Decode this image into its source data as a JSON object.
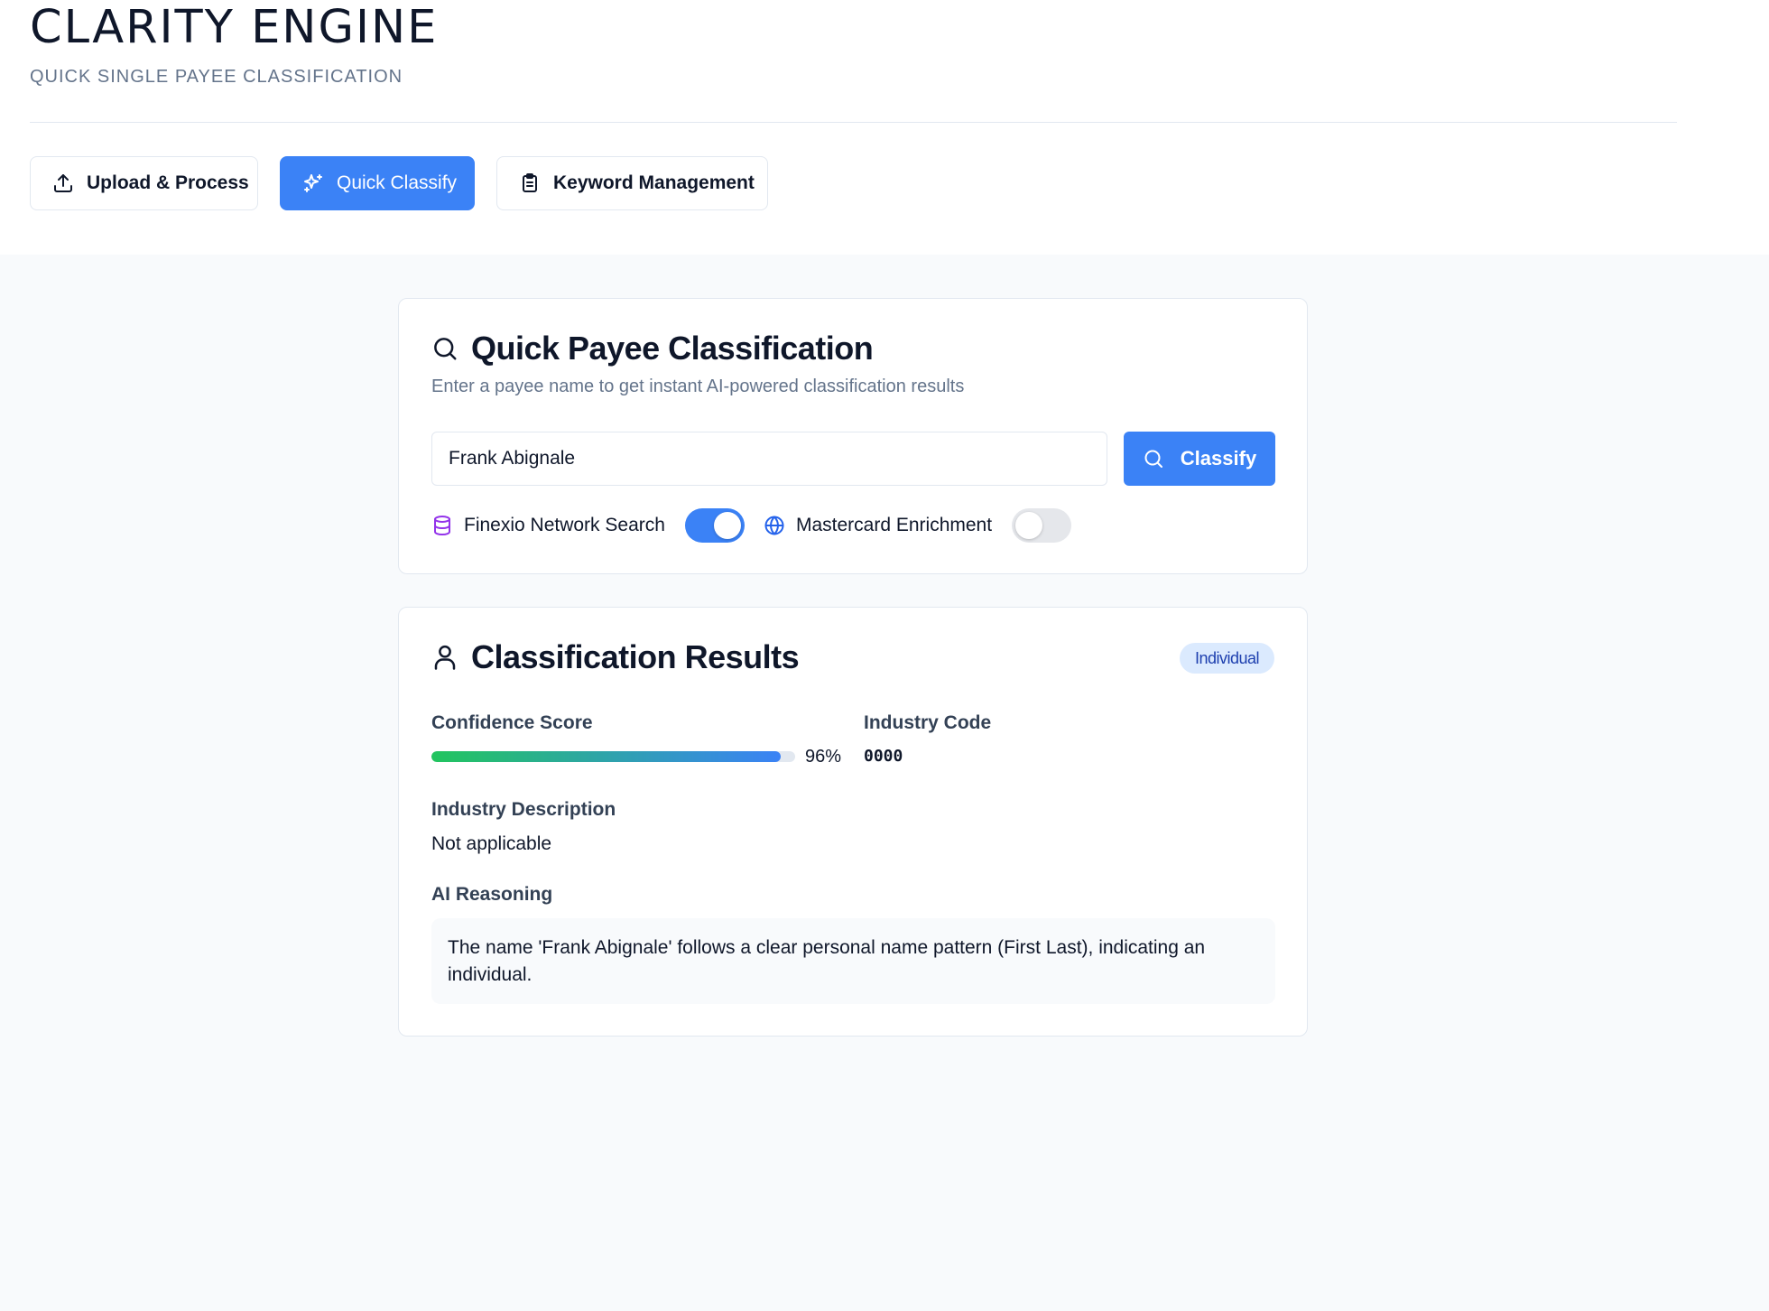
{
  "app": {
    "title": "CLARITY ENGINE",
    "subtitle": "QUICK SINGLE PAYEE CLASSIFICATION"
  },
  "tabs": [
    {
      "label": "Upload & Process",
      "icon": "upload-icon",
      "active": false
    },
    {
      "label": "Quick Classify",
      "icon": "sparkles-icon",
      "active": true
    },
    {
      "label": "Keyword Management",
      "icon": "clipboard-icon",
      "active": false
    }
  ],
  "classify_card": {
    "title": "Quick Payee Classification",
    "icon": "search-icon",
    "description": "Enter a payee name to get instant AI-powered classification results",
    "input": {
      "value": "Frank Abignale",
      "placeholder": ""
    },
    "button_label": "Classify",
    "options": [
      {
        "label": "Finexio Network Search",
        "icon": "database-icon",
        "enabled": true
      },
      {
        "label": "Mastercard Enrichment",
        "icon": "globe-icon",
        "enabled": false
      }
    ]
  },
  "results_card": {
    "title": "Classification Results",
    "icon": "user-icon",
    "badge": "Individual",
    "confidence": {
      "label": "Confidence Score",
      "value": 0.96,
      "display": "96%"
    },
    "industry_code": {
      "label": "Industry Code",
      "value": "0000"
    },
    "industry_description": {
      "label": "Industry Description",
      "value": "Not applicable"
    },
    "reasoning": {
      "label": "AI Reasoning",
      "text": "The name 'Frank Abignale' follows a clear personal name pattern (First Last), indicating an individual."
    }
  },
  "colors": {
    "accent": "#3b82f6",
    "badge_bg": "#dbeafe",
    "badge_text": "#1e40af",
    "progress_start": "#22c55e",
    "progress_end": "#3b82f6",
    "database_icon": "#9333ea",
    "globe_icon": "#2563eb"
  }
}
